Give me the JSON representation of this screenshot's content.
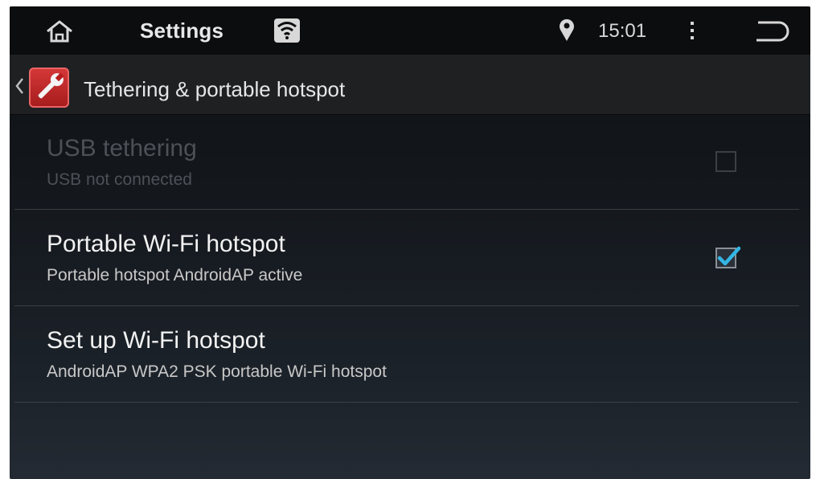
{
  "status_bar": {
    "app_title": "Settings",
    "time": "15:01",
    "icons": [
      "home-icon",
      "wifi-icon",
      "location-icon",
      "overflow-menu-icon",
      "back-icon"
    ]
  },
  "header": {
    "title": "Tethering & portable hotspot",
    "icons": [
      "up-chevron-icon",
      "settings-wrench-icon"
    ]
  },
  "items": [
    {
      "title": "USB tethering",
      "summary": "USB not connected",
      "enabled": false,
      "checkbox": {
        "visible": true,
        "checked": false
      }
    },
    {
      "title": "Portable Wi-Fi hotspot",
      "summary": "Portable hotspot AndroidAP active",
      "enabled": true,
      "checkbox": {
        "visible": true,
        "checked": true
      }
    },
    {
      "title": "Set up Wi-Fi hotspot",
      "summary": "AndroidAP WPA2 PSK portable Wi-Fi hotspot",
      "enabled": true,
      "checkbox": {
        "visible": false,
        "checked": false
      }
    }
  ],
  "colors": {
    "accent": "#33b5e5",
    "text_primary": "#f2f2f2",
    "text_secondary": "#c8c8c8",
    "text_disabled": "#4d5157",
    "icon_red": "#c62828"
  }
}
